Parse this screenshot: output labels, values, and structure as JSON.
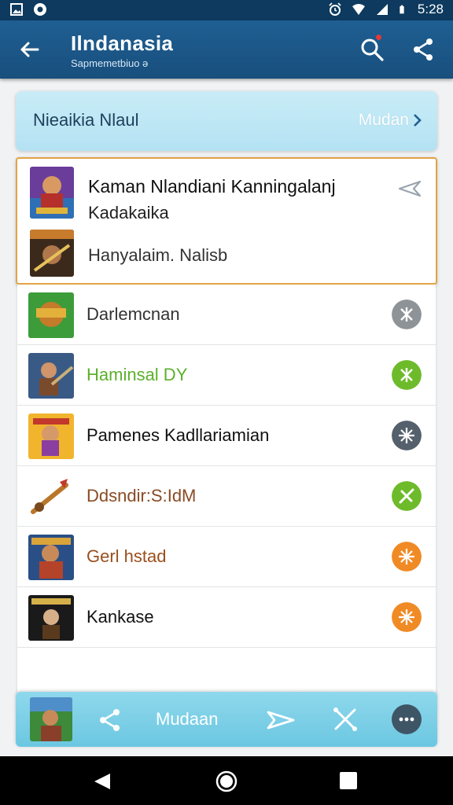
{
  "status_bar": {
    "time": "5:28",
    "left_icons": [
      "gallery-icon",
      "app-notification-icon"
    ],
    "right_icons": [
      "alarm-icon",
      "wifi-icon",
      "signal-icon",
      "battery-icon"
    ]
  },
  "app_bar": {
    "title": "Ilndanasia",
    "subtitle": "Sapmemetbiuo   ə",
    "background": "#1f5f93"
  },
  "banner": {
    "title": "Nieaikia Nlaul",
    "action_label": "Mudan"
  },
  "featured": {
    "title": "Kaman Nlandiani Kanningalanj",
    "subtitle": "Kadakaika",
    "secondary": "Hanyalaim. Nalisb",
    "border_color": "#e2a346"
  },
  "list": [
    {
      "label": "Darlemcnan",
      "label_color": "#333333",
      "action_color": "#8e9398"
    },
    {
      "label": "Haminsal DY",
      "label_color": "#5bb02a",
      "action_color": "#6dbb2a"
    },
    {
      "label": "Pamenes Kadllariamian",
      "label_color": "#111111",
      "action_color": "#54606c"
    },
    {
      "label": "Ddsndir:S:IdM",
      "label_color": "#8a4b23",
      "action_color": "#6dbb2a"
    },
    {
      "label": "Gerl hstad",
      "label_color": "#9a4f1d",
      "action_color": "#f08a24"
    },
    {
      "label": "Kankase",
      "label_color": "#111111",
      "action_color": "#f08a24"
    }
  ],
  "bottom_toolbar": {
    "label": "Mudaan",
    "background": "#7fd0e8"
  }
}
